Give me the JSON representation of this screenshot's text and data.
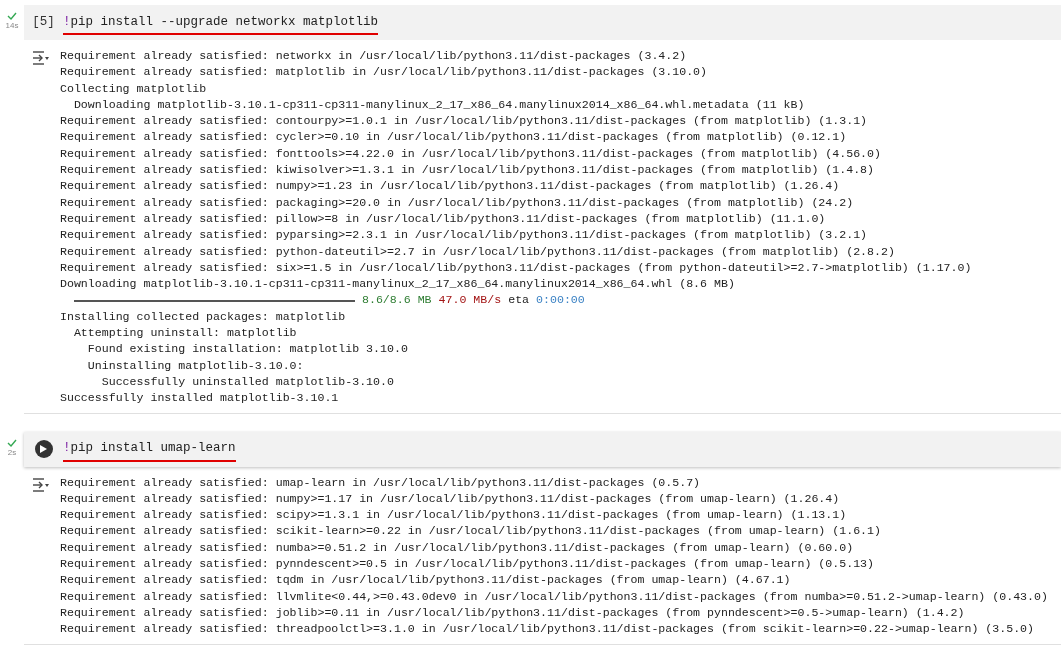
{
  "cells": [
    {
      "succeeded": true,
      "time": "14s",
      "run_button": false,
      "count": "[5]",
      "bang": "!",
      "code": "pip install --upgrade networkx matplotlib",
      "underlined": true,
      "output": [
        {
          "kind": "text",
          "text": "Requirement already satisfied: networkx in /usr/local/lib/python3.11/dist-packages (3.4.2)"
        },
        {
          "kind": "text",
          "text": "Requirement already satisfied: matplotlib in /usr/local/lib/python3.11/dist-packages (3.10.0)"
        },
        {
          "kind": "text",
          "text": "Collecting matplotlib"
        },
        {
          "kind": "text",
          "text": "  Downloading matplotlib-3.10.1-cp311-cp311-manylinux_2_17_x86_64.manylinux2014_x86_64.whl.metadata (11 kB)"
        },
        {
          "kind": "text",
          "text": "Requirement already satisfied: contourpy>=1.0.1 in /usr/local/lib/python3.11/dist-packages (from matplotlib) (1.3.1)"
        },
        {
          "kind": "text",
          "text": "Requirement already satisfied: cycler>=0.10 in /usr/local/lib/python3.11/dist-packages (from matplotlib) (0.12.1)"
        },
        {
          "kind": "text",
          "text": "Requirement already satisfied: fonttools>=4.22.0 in /usr/local/lib/python3.11/dist-packages (from matplotlib) (4.56.0)"
        },
        {
          "kind": "text",
          "text": "Requirement already satisfied: kiwisolver>=1.3.1 in /usr/local/lib/python3.11/dist-packages (from matplotlib) (1.4.8)"
        },
        {
          "kind": "text",
          "text": "Requirement already satisfied: numpy>=1.23 in /usr/local/lib/python3.11/dist-packages (from matplotlib) (1.26.4)"
        },
        {
          "kind": "text",
          "text": "Requirement already satisfied: packaging>=20.0 in /usr/local/lib/python3.11/dist-packages (from matplotlib) (24.2)"
        },
        {
          "kind": "text",
          "text": "Requirement already satisfied: pillow>=8 in /usr/local/lib/python3.11/dist-packages (from matplotlib) (11.1.0)"
        },
        {
          "kind": "text",
          "text": "Requirement already satisfied: pyparsing>=2.3.1 in /usr/local/lib/python3.11/dist-packages (from matplotlib) (3.2.1)"
        },
        {
          "kind": "text",
          "text": "Requirement already satisfied: python-dateutil>=2.7 in /usr/local/lib/python3.11/dist-packages (from matplotlib) (2.8.2)"
        },
        {
          "kind": "text",
          "text": "Requirement already satisfied: six>=1.5 in /usr/local/lib/python3.11/dist-packages (from python-dateutil>=2.7->matplotlib) (1.17.0)"
        },
        {
          "kind": "text",
          "text": "Downloading matplotlib-3.10.1-cp311-cp311-manylinux_2_17_x86_64.manylinux2014_x86_64.whl (8.6 MB)"
        },
        {
          "kind": "progress",
          "level": 1,
          "size": "8.6/8.6 MB",
          "speed": "47.0 MB/s",
          "eta_label": "eta",
          "eta": "0:00:00"
        },
        {
          "kind": "text",
          "text": "Installing collected packages: matplotlib"
        },
        {
          "kind": "text",
          "text": "  Attempting uninstall: matplotlib"
        },
        {
          "kind": "text",
          "text": "    Found existing installation: matplotlib 3.10.0"
        },
        {
          "kind": "text",
          "text": "    Uninstalling matplotlib-3.10.0:"
        },
        {
          "kind": "text",
          "text": "      Successfully uninstalled matplotlib-3.10.0"
        },
        {
          "kind": "text",
          "text": "Successfully installed matplotlib-3.10.1"
        }
      ]
    },
    {
      "succeeded": true,
      "time": "2s",
      "run_button": true,
      "bang": "!",
      "code": "pip install umap-learn",
      "underlined": true,
      "output": [
        {
          "kind": "text",
          "text": "Requirement already satisfied: umap-learn in /usr/local/lib/python3.11/dist-packages (0.5.7)"
        },
        {
          "kind": "text",
          "text": "Requirement already satisfied: numpy>=1.17 in /usr/local/lib/python3.11/dist-packages (from umap-learn) (1.26.4)"
        },
        {
          "kind": "text",
          "text": "Requirement already satisfied: scipy>=1.3.1 in /usr/local/lib/python3.11/dist-packages (from umap-learn) (1.13.1)"
        },
        {
          "kind": "text",
          "text": "Requirement already satisfied: scikit-learn>=0.22 in /usr/local/lib/python3.11/dist-packages (from umap-learn) (1.6.1)"
        },
        {
          "kind": "text",
          "text": "Requirement already satisfied: numba>=0.51.2 in /usr/local/lib/python3.11/dist-packages (from umap-learn) (0.60.0)"
        },
        {
          "kind": "text",
          "text": "Requirement already satisfied: pynndescent>=0.5 in /usr/local/lib/python3.11/dist-packages (from umap-learn) (0.5.13)"
        },
        {
          "kind": "text",
          "text": "Requirement already satisfied: tqdm in /usr/local/lib/python3.11/dist-packages (from umap-learn) (4.67.1)"
        },
        {
          "kind": "text",
          "text": "Requirement already satisfied: llvmlite<0.44,>=0.43.0dev0 in /usr/local/lib/python3.11/dist-packages (from numba>=0.51.2->umap-learn) (0.43.0)"
        },
        {
          "kind": "text",
          "text": "Requirement already satisfied: joblib>=0.11 in /usr/local/lib/python3.11/dist-packages (from pynndescent>=0.5->umap-learn) (1.4.2)"
        },
        {
          "kind": "text",
          "text": "Requirement already satisfied: threadpoolctl>=3.1.0 in /usr/local/lib/python3.11/dist-packages (from scikit-learn>=0.22->umap-learn) (3.5.0)"
        }
      ]
    }
  ]
}
